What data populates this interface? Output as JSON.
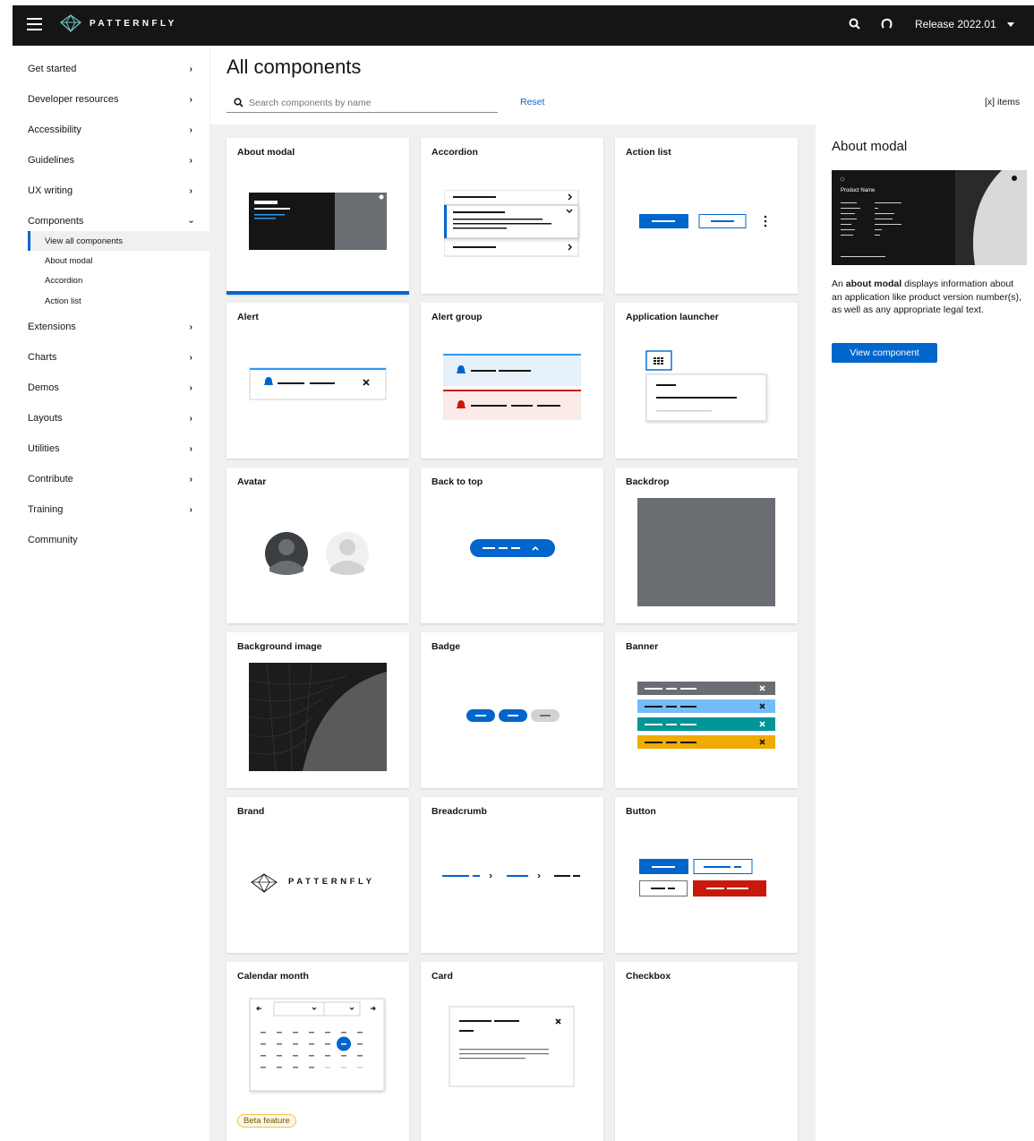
{
  "header": {
    "logo_text": "PATTERNFLY",
    "release_label": "Release 2022.01"
  },
  "sidebar": {
    "items": [
      {
        "label": "Get started"
      },
      {
        "label": "Developer resources"
      },
      {
        "label": "Accessibility"
      },
      {
        "label": "Guidelines"
      },
      {
        "label": "UX writing"
      },
      {
        "label": "Components"
      },
      {
        "label": "Extensions"
      },
      {
        "label": "Charts"
      },
      {
        "label": "Demos"
      },
      {
        "label": "Layouts"
      },
      {
        "label": "Utilities"
      },
      {
        "label": "Contribute"
      },
      {
        "label": "Training"
      },
      {
        "label": "Community"
      }
    ],
    "sub_items": [
      {
        "label": "View all components"
      },
      {
        "label": "About modal"
      },
      {
        "label": "Accordion"
      },
      {
        "label": "Action list"
      }
    ]
  },
  "main": {
    "title": "All components",
    "search_placeholder": "Search components by name",
    "reset_label": "Reset",
    "items_count": "[x] items"
  },
  "cards": [
    {
      "title": "About modal"
    },
    {
      "title": "Accordion"
    },
    {
      "title": "Action list"
    },
    {
      "title": "Alert"
    },
    {
      "title": "Alert group"
    },
    {
      "title": "Application launcher"
    },
    {
      "title": "Avatar"
    },
    {
      "title": "Back to top"
    },
    {
      "title": "Backdrop"
    },
    {
      "title": "Background image"
    },
    {
      "title": "Badge"
    },
    {
      "title": "Banner"
    },
    {
      "title": "Brand"
    },
    {
      "title": "Breadcrumb"
    },
    {
      "title": "Button"
    },
    {
      "title": "Calendar month",
      "badge": "Beta feature"
    },
    {
      "title": "Card"
    },
    {
      "title": "Checkbox"
    }
  ],
  "brand_logo_text": "PATTERNFLY",
  "detail": {
    "title": "About modal",
    "image_product_name": "Product Name",
    "desc_prefix": "An ",
    "desc_bold": "about modal",
    "desc_suffix": " displays information about an application like product version number(s), as well as any appropriate legal text.",
    "button_label": "View component"
  },
  "colors": {
    "accent": "#0066cc",
    "masthead": "#151515",
    "danger": "#c9190b",
    "info_light": "#73bcf7",
    "teal": "#009596",
    "gold": "#f0ab00"
  }
}
